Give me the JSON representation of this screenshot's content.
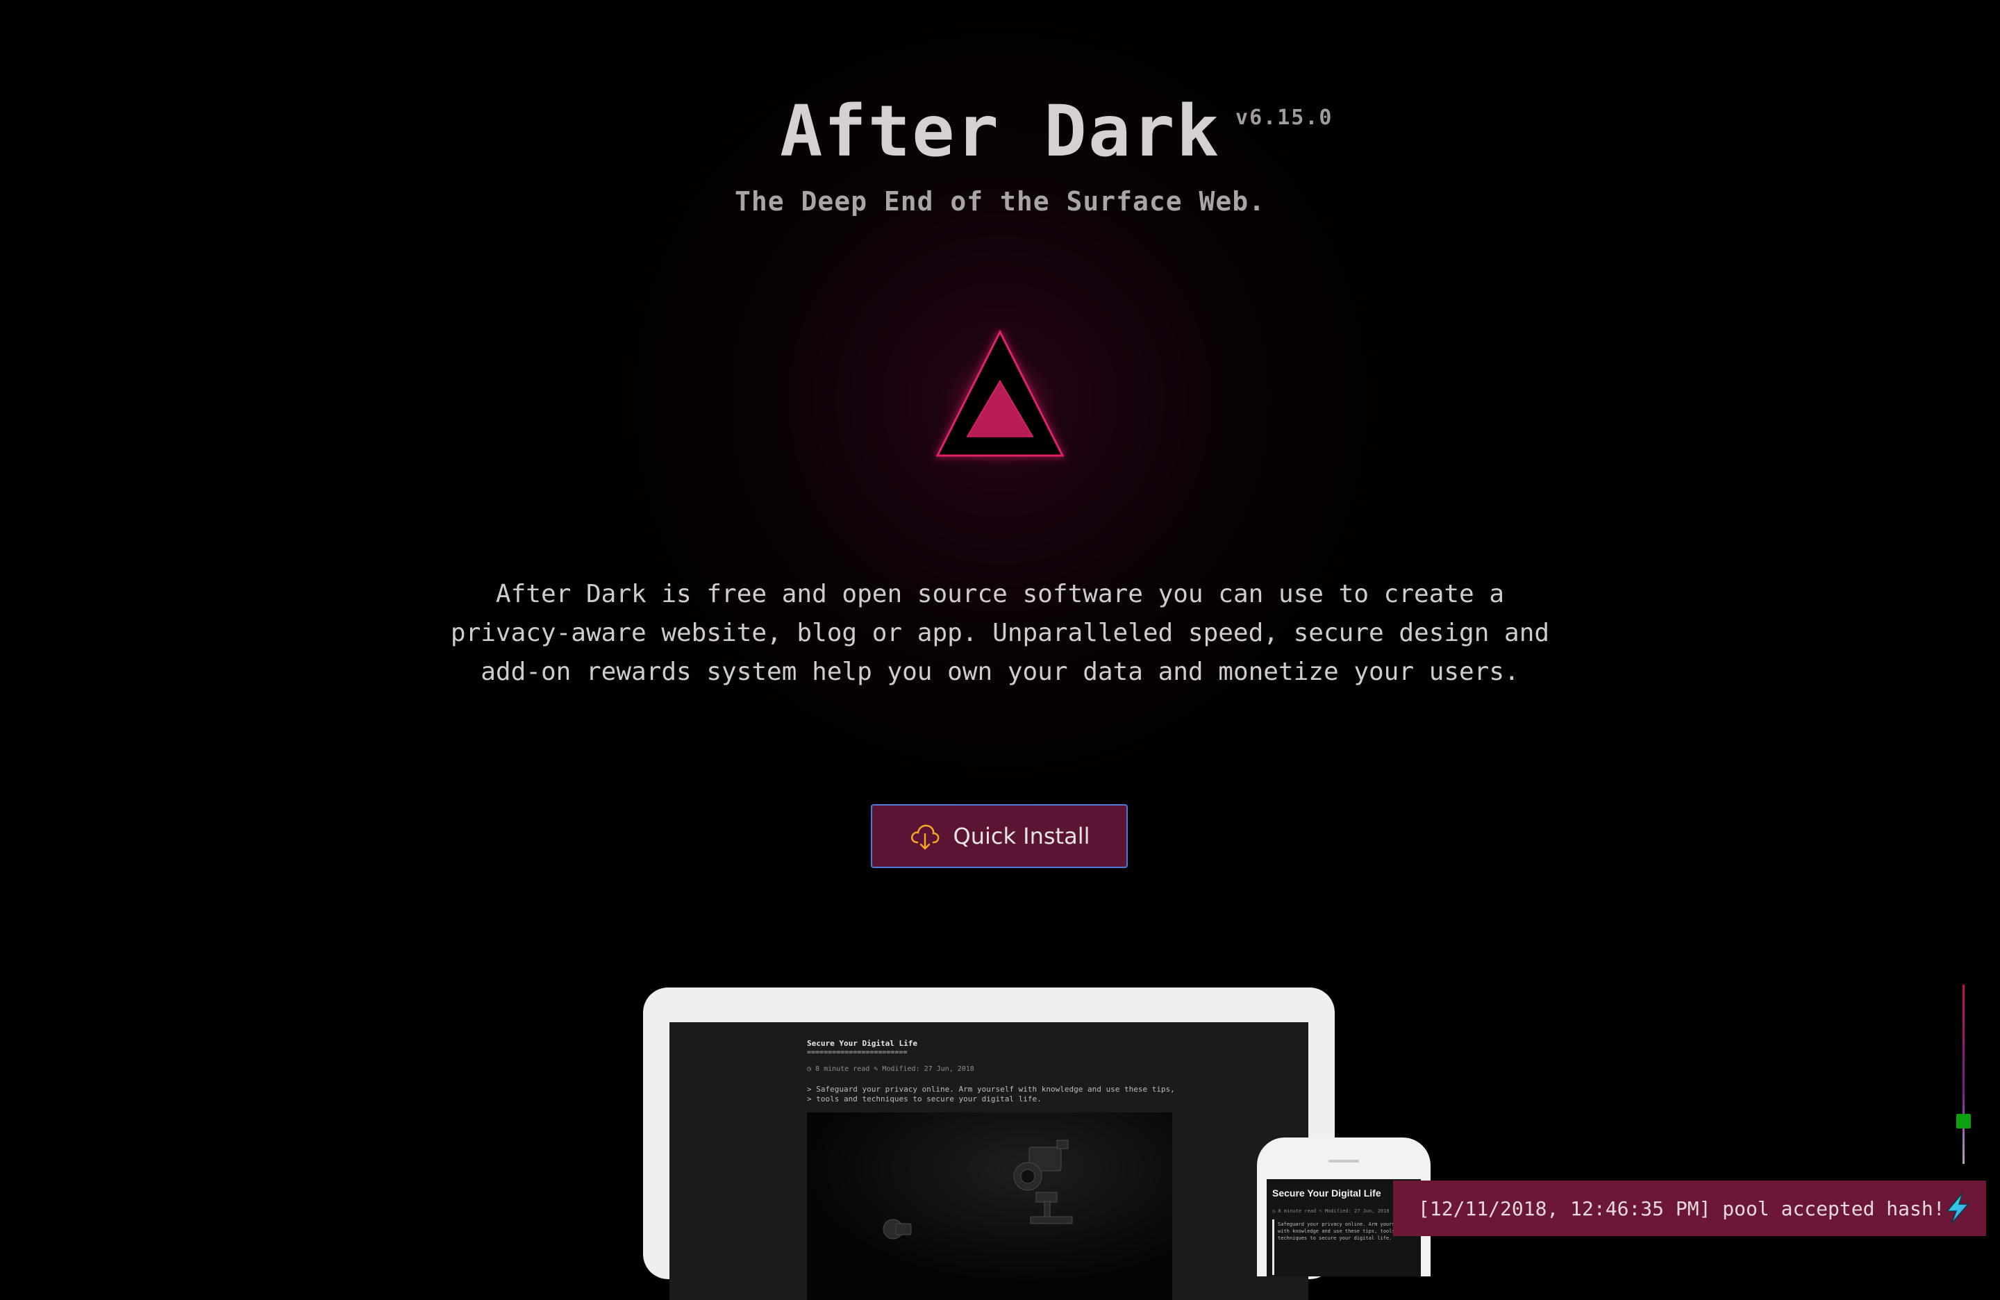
{
  "header": {
    "title": "After Dark",
    "version": "v6.15.0",
    "tagline": "The Deep End of the Surface Web."
  },
  "intro": {
    "line1": "After Dark is free and open source software you can use to create a",
    "line2": "privacy-aware website, blog or app. Unparalleled speed, secure design and",
    "line3": "add-on rewards system help you own your data and monetize your users."
  },
  "install_button": {
    "label": "Quick Install",
    "icon": "cloud-download-icon",
    "accent": "#f5a623"
  },
  "laptop_preview": {
    "article_title": "Secure Your Digital Life",
    "rule": "========================",
    "meta": "◷ 8 minute read ✎ Modified: 27 Jun, 2018",
    "quote_line1": "> Safeguard your privacy online. Arm yourself with knowledge and use these tips,",
    "quote_line2": "> tools and techniques to secure your digital life."
  },
  "phone_preview": {
    "article_title": "Secure Your Digital Life",
    "meta": "◷ 8 minute read ✎ Modified: 27 Jun, 2018",
    "text": "Safeguard your privacy online. Arm yourself with knowledge and use these tips, tools and techniques to secure your digital life."
  },
  "toast": {
    "message": "[12/11/2018, 12:46:35 PM] pool accepted hash!",
    "icon": "lightning-icon"
  },
  "colors": {
    "background": "#000000",
    "brand_pink": "#e0246a",
    "button_bg": "#5b1434",
    "button_border": "#4a7bd8",
    "toast_bg": "#6c1738",
    "slider_thumb": "#0ca10f"
  }
}
